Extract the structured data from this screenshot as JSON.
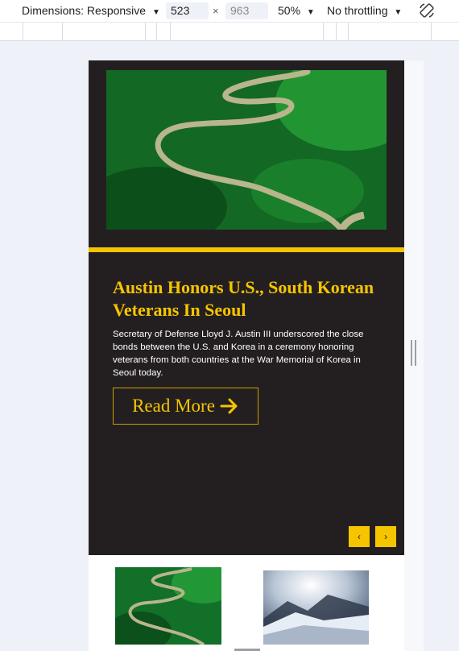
{
  "toolbar": {
    "dimensions_label": "Dimensions: Responsive",
    "width_value": "523",
    "height_placeholder": "963",
    "times": "×",
    "zoom": "50%",
    "throttling": "No throttling",
    "caret": "▼",
    "rotate_icon": "rotate-icon"
  },
  "hero": {
    "title": "Austin Honors U.S., South Korean Veterans In Seoul",
    "description": "Secretary of Defense Lloyd J. Austin III underscored the close bonds between the U.S. and Korea in a ceremony honoring veterans from both countries at the War Memorial of Korea in Seoul today.",
    "read_more": "Read More",
    "prev": "‹",
    "next": "›"
  },
  "colors": {
    "accent": "#f7c500",
    "hero_bg": "#231f20"
  }
}
